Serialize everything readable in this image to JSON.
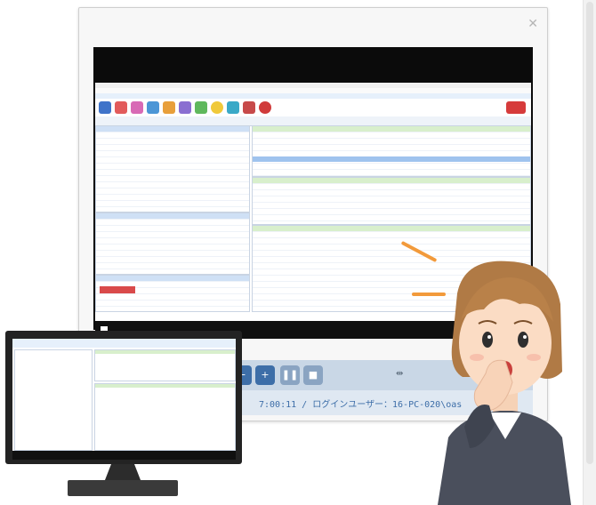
{
  "viewer": {
    "close_icon": "close-icon",
    "status_text": "7:00:11 / ログインユーザー：16-PC-020\\oas",
    "controls": {
      "zoom_out_icon": "zoom-out-icon",
      "zoom_in_icon": "zoom-in-icon",
      "pause_icon": "pause-icon",
      "stop_icon": "stop-icon",
      "fit_icon": "fit-screen-icon"
    }
  },
  "colors": {
    "accent_blue": "#3d6ea8",
    "toolbar_bg": "#dfe8f2",
    "screen_black": "#0b0b0b",
    "section_green": "#d8efcc",
    "highlight_blue": "#9fc3ee",
    "annotation_orange": "#f29a3b"
  }
}
